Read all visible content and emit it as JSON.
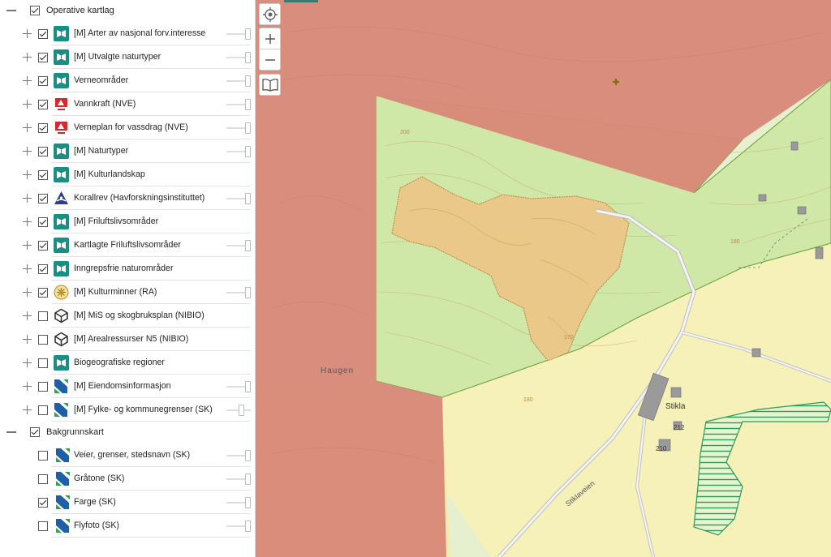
{
  "groups": [
    {
      "label": "Operative kartlag",
      "checked": true,
      "layers": [
        {
          "label": "[M] Arter av nasjonal forv.interesse",
          "checked": true,
          "icon": "miljo-icon",
          "slider": true
        },
        {
          "label": "[M] Utvalgte naturtyper",
          "checked": true,
          "icon": "miljo-icon",
          "slider": true
        },
        {
          "label": "Verneområder",
          "checked": true,
          "icon": "miljo-icon",
          "slider": true
        },
        {
          "label": "Vannkraft (NVE)",
          "checked": true,
          "icon": "nve-icon",
          "slider": true
        },
        {
          "label": "Verneplan for vassdrag (NVE)",
          "checked": true,
          "icon": "nve-icon",
          "slider": true
        },
        {
          "label": "[M] Naturtyper",
          "checked": true,
          "icon": "miljo-icon",
          "slider": true
        },
        {
          "label": "[M] Kulturlandskap",
          "checked": true,
          "icon": "miljo-icon",
          "slider": false
        },
        {
          "label": "Korallrev (Havforskningsinstituttet)",
          "checked": true,
          "icon": "havforskning-icon",
          "slider": true
        },
        {
          "label": "[M] Friluftslivsområder",
          "checked": true,
          "icon": "miljo-icon",
          "slider": false
        },
        {
          "label": "Kartlagte Friluftslivsområder",
          "checked": true,
          "icon": "miljo-icon",
          "slider": true
        },
        {
          "label": "Inngrepsfrie naturområder",
          "checked": true,
          "icon": "miljo-icon",
          "slider": false
        },
        {
          "label": "[M] Kulturminner (RA)",
          "checked": true,
          "icon": "riksantikvaren-icon",
          "slider": true
        },
        {
          "label": "[M] MiS og skogbruksplan (NIBIO)",
          "checked": false,
          "icon": "nibio-icon",
          "slider": false
        },
        {
          "label": "[M] Arealressurser N5 (NIBIO)",
          "checked": false,
          "icon": "nibio-icon",
          "slider": false
        },
        {
          "label": "Biogeografiske regioner",
          "checked": false,
          "icon": "miljo-icon",
          "slider": false
        },
        {
          "label": "[M] Eiendomsinformasjon",
          "checked": false,
          "icon": "kartverket-icon",
          "slider": true
        },
        {
          "label": "[M] Fylke- og kommunegrenser (SK)",
          "checked": false,
          "icon": "kartverket-icon",
          "slider": true
        }
      ]
    },
    {
      "label": "Bakgrunnskart",
      "checked": true,
      "layers": [
        {
          "label": "Veier, grenser, stedsnavn (SK)",
          "checked": false,
          "icon": "kartverket-icon",
          "slider": true
        },
        {
          "label": "Gråtone (SK)",
          "checked": false,
          "icon": "kartverket-icon",
          "slider": true
        },
        {
          "label": "Farge (SK)",
          "checked": true,
          "icon": "kartverket-icon",
          "slider": true
        },
        {
          "label": "Flyfoto (SK)",
          "checked": false,
          "icon": "kartverket-icon",
          "slider": true
        }
      ]
    }
  ],
  "map": {
    "place_names": [
      "Haugen",
      "Stikla",
      "Stiklaveien"
    ],
    "building_numbers": [
      "212",
      "210"
    ],
    "contour_labels": [
      "200",
      "180",
      "170",
      "180"
    ],
    "colors": {
      "protected_area": "#d88878",
      "nature_type": "#cfe8a8",
      "farmland": "#f6f1b8",
      "quarry": "#e9c88a",
      "wetland_hatch": "#2d9a5a"
    },
    "controls": [
      "locate-icon",
      "zoom-in-icon",
      "zoom-out-icon",
      "legend-book-icon"
    ]
  }
}
